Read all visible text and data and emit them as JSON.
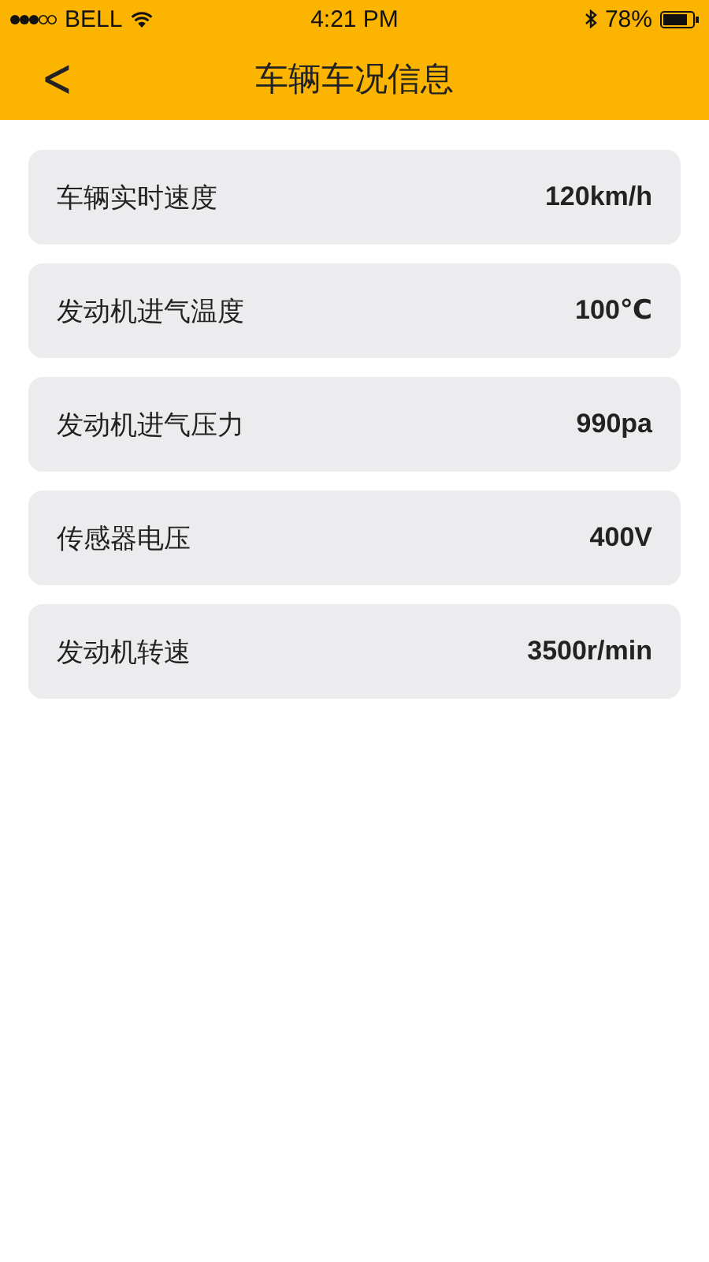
{
  "status_bar": {
    "carrier": "BELL",
    "time": "4:21 PM",
    "battery": "78%"
  },
  "header": {
    "back": "<",
    "title": "车辆车况信息"
  },
  "items": [
    {
      "label": "车辆实时速度",
      "value": "120km/h"
    },
    {
      "label": "发动机进气温度",
      "value": "100℃"
    },
    {
      "label": "发动机进气压力",
      "value": "990pa"
    },
    {
      "label": "传感器电压",
      "value": "400V"
    },
    {
      "label": "发动机转速",
      "value": "3500r/min"
    }
  ]
}
